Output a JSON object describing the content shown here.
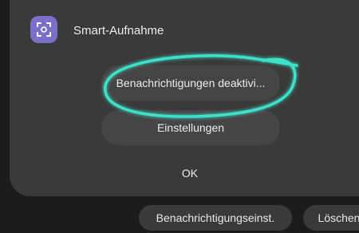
{
  "dialog": {
    "app_name": "Smart-Aufnahme",
    "app_icon": "smart-capture-icon",
    "buttons": {
      "disable_notifications": "Benachrichtigungen deaktivi...",
      "settings": "Einstellungen",
      "ok": "OK"
    }
  },
  "annotation": {
    "color": "#3de0c8"
  },
  "bottom_bar": {
    "notification_settings": "Benachrichtigungseinst.",
    "delete": "Löschen"
  },
  "colors": {
    "background": "#1c1c1c",
    "dialog": "#3a3a3a",
    "button": "#454545",
    "icon": "#7a6fc9"
  }
}
